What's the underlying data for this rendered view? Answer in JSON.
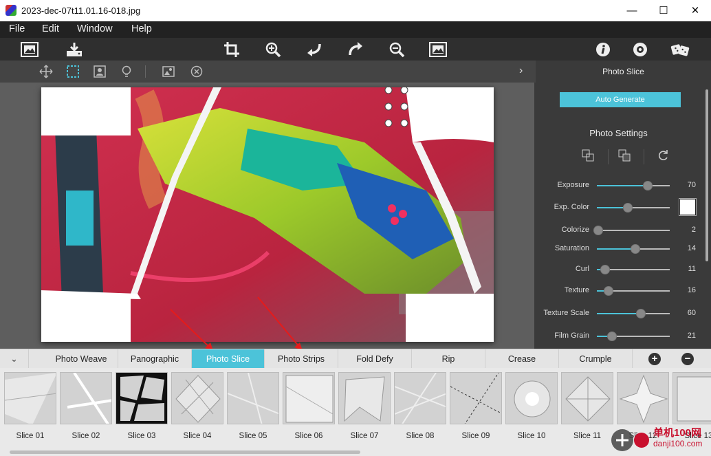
{
  "window": {
    "title": "2023-dec-07t11.01.16-018.jpg",
    "minimize": "—",
    "maximize": "☐",
    "close": "✕"
  },
  "menu": [
    "File",
    "Edit",
    "Window",
    "Help"
  ],
  "toolbar": {
    "icons": [
      "open-image-icon",
      "save-icon",
      "crop-icon",
      "zoom-in-icon",
      "undo-icon",
      "redo-icon",
      "zoom-out-icon",
      "fit-image-icon",
      "info-icon",
      "settings-icon",
      "random-dice-icon"
    ]
  },
  "subtoolbar": {
    "icons": [
      "move-icon",
      "select-rect-icon",
      "portrait-crop-icon",
      "lightbulb-icon",
      "image-mask-icon",
      "close-circle-icon"
    ]
  },
  "panel": {
    "title": "Photo Slice",
    "auto_generate": "Auto Generate",
    "section_title": "Photo Settings",
    "settings": [
      {
        "label": "Exposure",
        "value": "70",
        "level": 0.7
      },
      {
        "label": "Exp. Color",
        "value": "",
        "level": 0.42
      },
      {
        "label": "Colorize",
        "value": "2",
        "level": 0.02
      },
      {
        "label": "Saturation",
        "value": "14",
        "level": 0.53
      },
      {
        "label": "Curl",
        "value": "11",
        "level": 0.11
      },
      {
        "label": "Texture",
        "value": "16",
        "level": 0.16
      },
      {
        "label": "Texture Scale",
        "value": "60",
        "level": 0.6
      },
      {
        "label": "Film Grain",
        "value": "21",
        "level": 0.21
      }
    ],
    "accent": "#4cc3d9",
    "exp_color": "#ffffff"
  },
  "tabs": {
    "items": [
      "Photo Weave",
      "Panographic",
      "Photo Slice",
      "Photo Strips",
      "Fold Defy",
      "Rip",
      "Crease",
      "Crumple"
    ],
    "active": "Photo Slice",
    "add": "+",
    "remove": "−"
  },
  "presets": [
    "Slice 01",
    "Slice 02",
    "Slice 03",
    "Slice 04",
    "Slice 05",
    "Slice 06",
    "Slice 07",
    "Slice 08",
    "Slice 09",
    "Slice 10",
    "Slice 11",
    "Slice 12",
    "Slice 13"
  ],
  "watermark": {
    "site": "单机100网",
    "url": "danji100.com"
  }
}
